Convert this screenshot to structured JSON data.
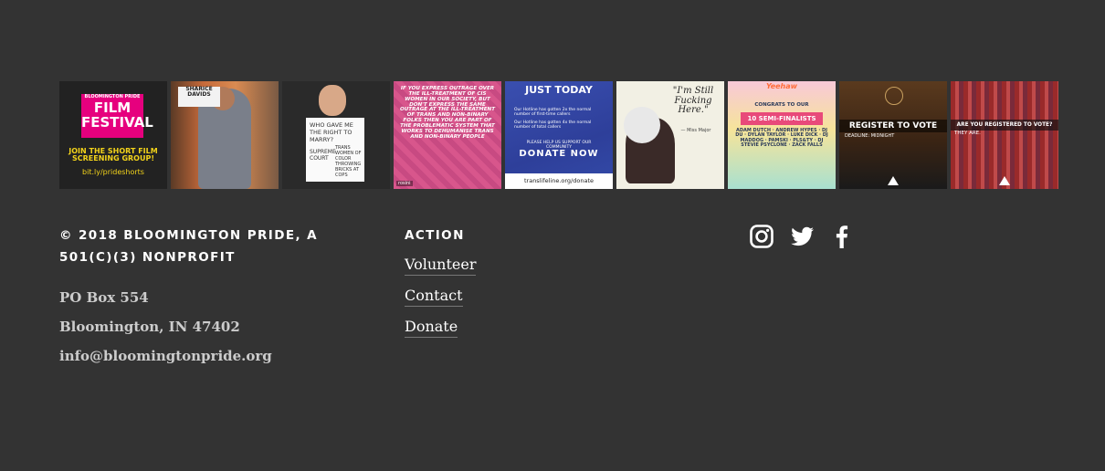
{
  "gallery": {
    "tiles": [
      {
        "label_small": "BLOOMINGTON PRIDE",
        "label_big": "FILM FESTIVAL",
        "line": "JOIN THE SHORT FILM SCREENING GROUP!",
        "url": "bit.ly/prideshorts"
      },
      {
        "sign": "SHARICE DAVIDS"
      },
      {
        "sign1": "WHO GAVE ME THE RIGHT TO MARRY?",
        "sign2": "SUPREME COURT",
        "sign3": "TRANS WOMEN OF COLOR THROWING BRICKS AT COPS"
      },
      {
        "text": "IF YOU EXPRESS OUTRAGE OVER THE ILL-TREATMENT OF CIS WOMEN IN OUR SOCIETY, BUT DON'T EXPRESS THE SAME OUTRAGE AT THE ILL-TREATMENT OF TRANS AND NON-BINARY FOLKS THEN YOU ARE PART OF THE PROBLEMATIC SYSTEM THAT WORKS TO DEHUMANISE TRANS AND NON-BINARY PEOPLE",
        "badge": "rosini"
      },
      {
        "heading": "JUST TODAY",
        "line1": "Our Hotline has gotten 2x the normal number of first-time callers",
        "line2": "Our Hotline has gotten 4x the normal number of total callers",
        "line3": "PLEASE HELP US SUPPORT OUR COMMUNITY",
        "donate": "DONATE NOW",
        "url": "translifeline.org/donate"
      },
      {
        "quote": "\"I'm Still Fucking Here.\"",
        "sig": "— Miss Major"
      },
      {
        "title": "Yeehaw",
        "banner": "10 SEMI-FINALISTS",
        "line": "CONGRATS TO OUR",
        "names": "ADAM DUTCH · ANDREW HYPES · DJ DU · DYLAN TAYLOR · LUKE DICK · DJ MADDOG · PAMSKI · PLS&TY · DJ STEVIE PSYCLONE · ZACK FALLS"
      },
      {
        "heading": "REGISTER TO VOTE",
        "sub": "DEADLINE: MIDNIGHT"
      },
      {
        "heading": "ARE YOU REGISTERED TO VOTE?",
        "sub": "THEY ARE."
      }
    ]
  },
  "footer": {
    "copyright": "© 2018 BLOOMINGTON PRIDE, A 501(C)(3) NONPROFIT",
    "address_line1": "PO Box 554",
    "address_line2": "Bloomington, IN 47402",
    "email": "info@bloomingtonpride.org",
    "action_heading": "ACTION",
    "links": [
      "Volunteer",
      "Contact",
      "Donate"
    ],
    "social": [
      "instagram-icon",
      "twitter-icon",
      "facebook-icon"
    ]
  },
  "colors": {
    "background": "#333333",
    "text": "#ffffff",
    "muted": "#cccccc"
  }
}
